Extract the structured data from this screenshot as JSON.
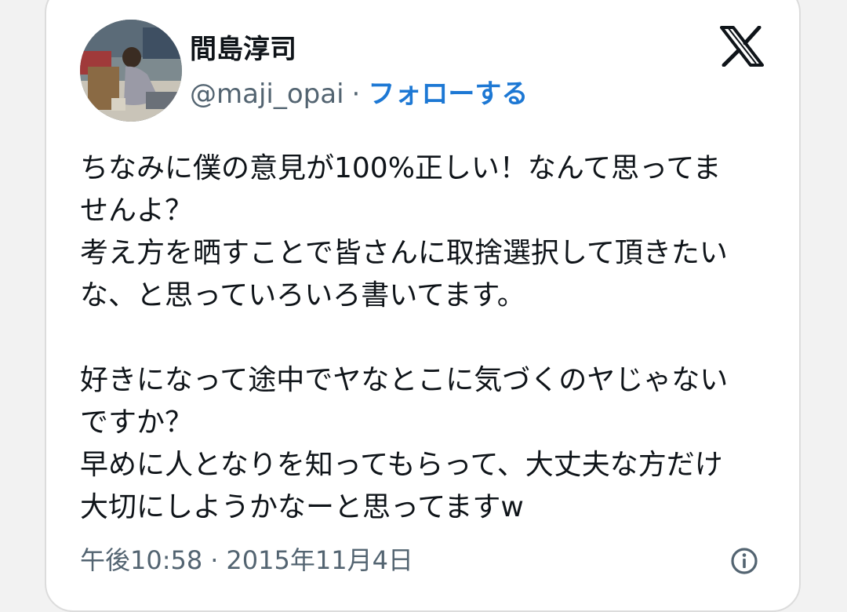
{
  "author": {
    "display_name": "間島淳司",
    "handle": "@maji_opai",
    "separator": "·",
    "follow_label": "フォローする"
  },
  "platform_icon": "x-logo-icon",
  "tweet": {
    "lines": [
      "ちなみに僕の意見が100%正しい！なんて思ってま",
      "せんよ？",
      "考え方を晒すことで皆さんに取捨選択して頂きたい",
      "な、と思っていろいろ書いてます。",
      "",
      "好きになって途中でヤなとこに気づくのヤじゃない",
      "ですか？",
      "早めに人となりを知ってもらって、大丈夫な方だけ",
      "大切にしようかなーと思ってますw"
    ]
  },
  "meta": {
    "time": "午後10:58",
    "separator": "·",
    "date": "2015年11月4日",
    "info_icon": "info-icon"
  },
  "colors": {
    "text": "#0f1419",
    "secondary": "#536471",
    "link": "#1d78d4",
    "card_border": "#dcdcdc",
    "background": "#f2f2f2"
  }
}
